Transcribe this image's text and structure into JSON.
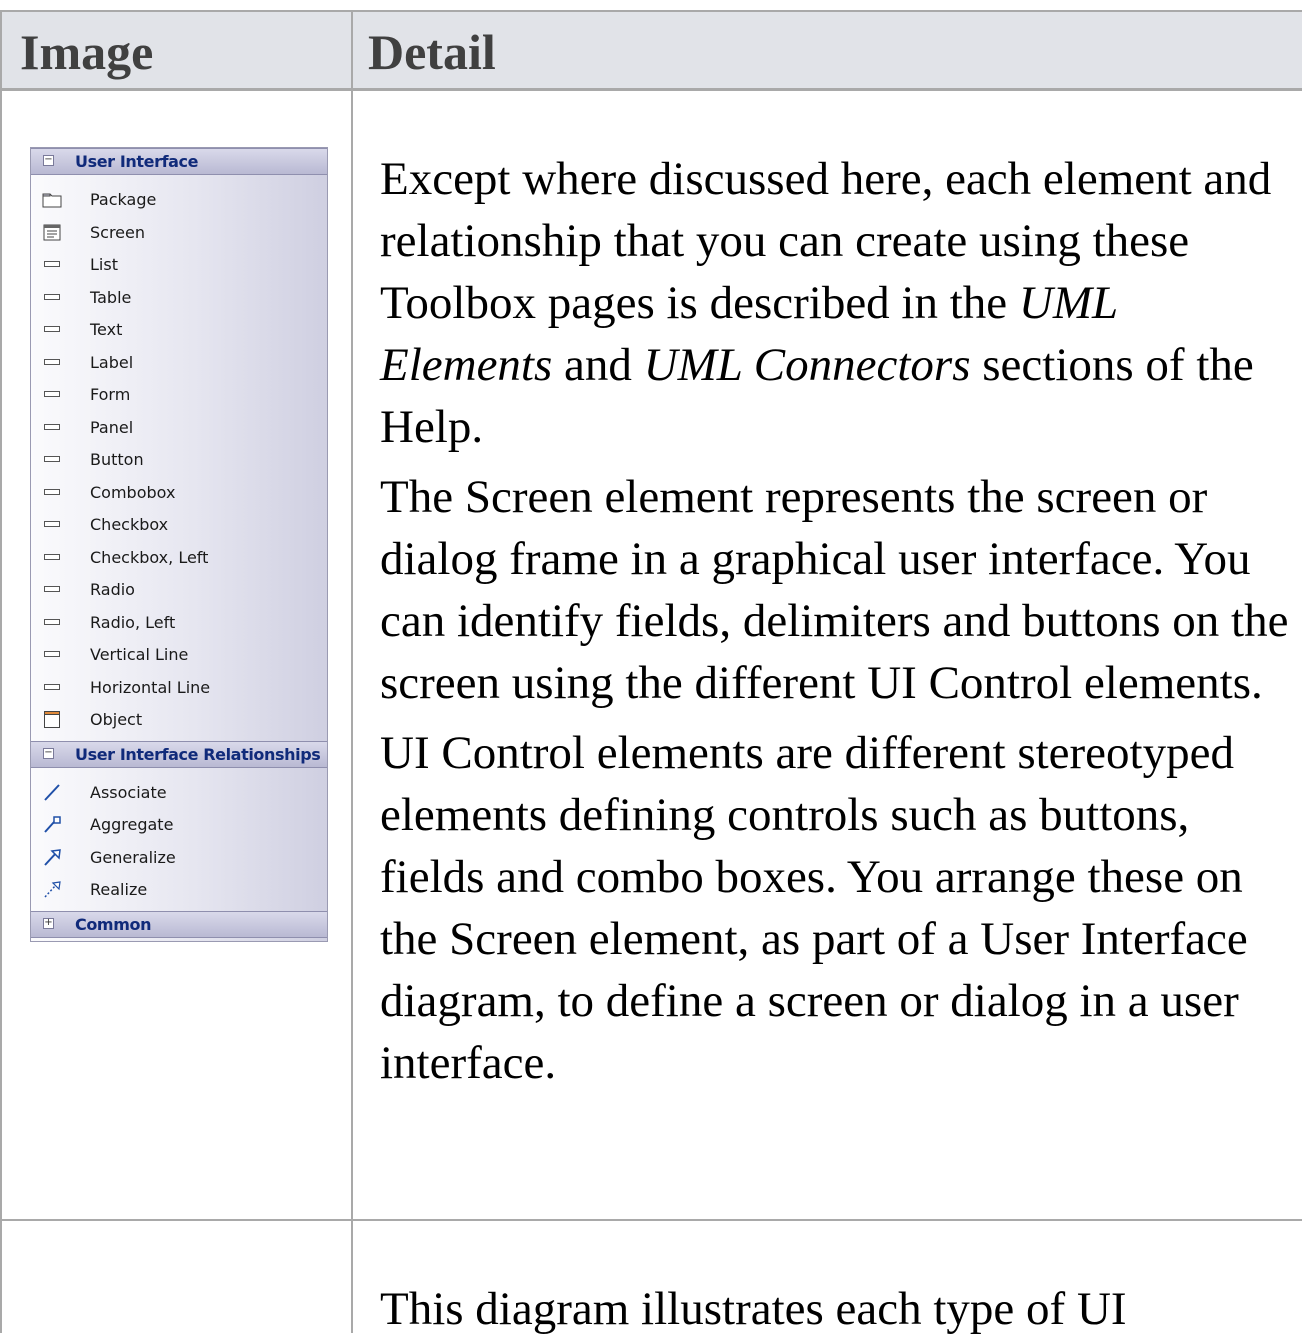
{
  "table": {
    "headers": {
      "image": "Image",
      "detail": "Detail"
    }
  },
  "toolbox": {
    "sections": [
      {
        "title": "User Interface",
        "toggle": "−",
        "items": [
          {
            "label": "Package",
            "icon": "package-icon"
          },
          {
            "label": "Screen",
            "icon": "screen-icon"
          },
          {
            "label": "List",
            "icon": "ui-control-icon"
          },
          {
            "label": "Table",
            "icon": "ui-control-icon"
          },
          {
            "label": "Text",
            "icon": "ui-control-icon"
          },
          {
            "label": "Label",
            "icon": "ui-control-icon"
          },
          {
            "label": "Form",
            "icon": "ui-control-icon"
          },
          {
            "label": "Panel",
            "icon": "ui-control-icon"
          },
          {
            "label": "Button",
            "icon": "ui-control-icon"
          },
          {
            "label": "Combobox",
            "icon": "ui-control-icon"
          },
          {
            "label": "Checkbox",
            "icon": "ui-control-icon"
          },
          {
            "label": "Checkbox, Left",
            "icon": "ui-control-icon"
          },
          {
            "label": "Radio",
            "icon": "ui-control-icon"
          },
          {
            "label": "Radio, Left",
            "icon": "ui-control-icon"
          },
          {
            "label": "Vertical Line",
            "icon": "ui-control-icon"
          },
          {
            "label": "Horizontal Line",
            "icon": "ui-control-icon"
          },
          {
            "label": "Object",
            "icon": "object-icon"
          }
        ]
      },
      {
        "title": "User Interface Relationships",
        "toggle": "−",
        "items": [
          {
            "label": "Associate",
            "icon": "associate-icon"
          },
          {
            "label": "Aggregate",
            "icon": "aggregate-icon"
          },
          {
            "label": "Generalize",
            "icon": "generalize-icon"
          },
          {
            "label": "Realize",
            "icon": "realize-icon"
          }
        ]
      },
      {
        "title": "Common",
        "toggle": "+",
        "items": []
      }
    ]
  },
  "detail": {
    "p1": {
      "a": "Except where discussed here, each element and relationship that you can create using these Toolbox pages is described in the ",
      "em1": "UML Elements",
      "b": " and ",
      "em2": "UML Connectors",
      "c": " sections of the Help."
    },
    "p2": "The Screen element represents the screen or dialog frame in a graphical user interface. You can identify fields, delimiters and buttons on the screen using the different UI Control elements.",
    "p3": "UI Control elements are different stereotyped elements defining controls such as buttons, fields and combo boxes. You arrange these on the Screen element, as part of a User Interface diagram, to define a screen or dialog in a user interface.",
    "row2_text": "This diagram illustrates each type of UI"
  }
}
